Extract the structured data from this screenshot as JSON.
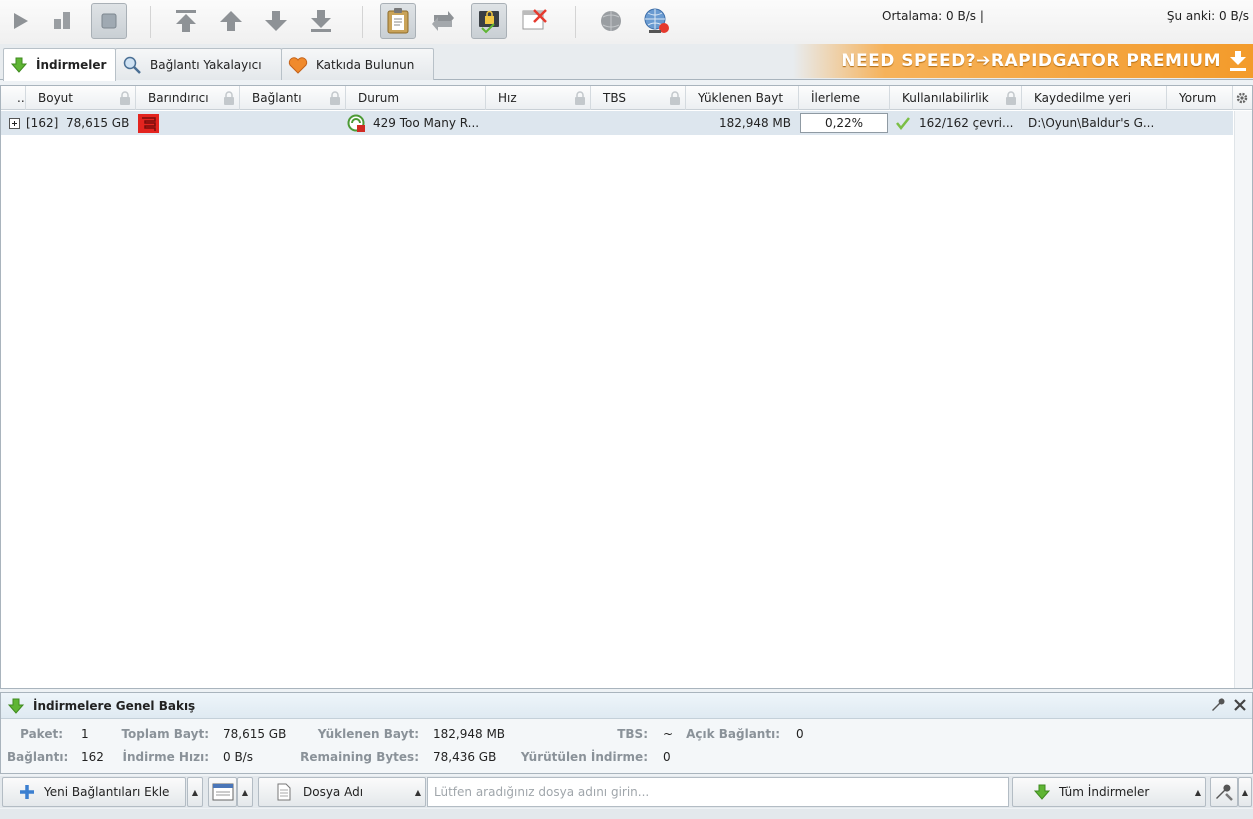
{
  "toolbar": {
    "avg_speed": "Ortalama: 0 B/s |",
    "current_speed": "Şu anki: 0 B/s"
  },
  "tabs": [
    {
      "label": "İndirmeler",
      "icon": "download-arrow-icon"
    },
    {
      "label": "Bağlantı Yakalayıcı",
      "icon": "magnifier-icon"
    },
    {
      "label": "Katkıda Bulunun",
      "icon": "heart-icon"
    }
  ],
  "promo": {
    "text": "NEED SPEED?➔RAPIDGATOR PREMIUM"
  },
  "columns": {
    "dot": "..",
    "size": "Boyut",
    "host": "Barındırıcı",
    "connection": "Bağlantı",
    "status": "Durum",
    "speed": "Hız",
    "eta": "TBS",
    "loaded": "Yüklenen Bayt",
    "progress": "İlerleme",
    "availability": "Kullanılabilirlik",
    "save_to": "Kaydedilme yeri",
    "comment": "Yorum"
  },
  "rows": [
    {
      "expander": "[162]",
      "size": "78,615 GB",
      "status": "429 Too Many R...",
      "loaded": "182,948 MB",
      "progress": "0,22%",
      "availability": "162/162 çevri...",
      "save_to": "D:\\Oyun\\Baldur's G..."
    }
  ],
  "overview": {
    "title": "İndirmelere Genel Bakış",
    "packages_label": "Paket:",
    "packages": "1",
    "total_label": "Toplam Bayt:",
    "total": "78,615 GB",
    "loaded_label": "Yüklenen Bayt:",
    "loaded": "182,948 MB",
    "eta_label": "TBS:",
    "eta": "~",
    "open_conn_label": "Açık Bağlantı:",
    "open_conn": "0",
    "links_label": "Bağlantı:",
    "links": "162",
    "dlspeed_label": "İndirme Hızı:",
    "dlspeed": "0 B/s",
    "remaining_label": "Remaining Bytes:",
    "remaining": "78,436 GB",
    "running_label": "Yürütülen İndirme:",
    "running": "0"
  },
  "bottom": {
    "add_links": "Yeni Bağlantıları Ekle",
    "filter_field": "Dosya Adı",
    "search_placeholder": "Lütfen aradığınız dosya adını girin...",
    "view_filter": "Tüm İndirmeler"
  },
  "colors": {
    "accent_green": "#5fb534",
    "promo_orange": "#f39b2b",
    "row_selected": "#dde6ee"
  }
}
